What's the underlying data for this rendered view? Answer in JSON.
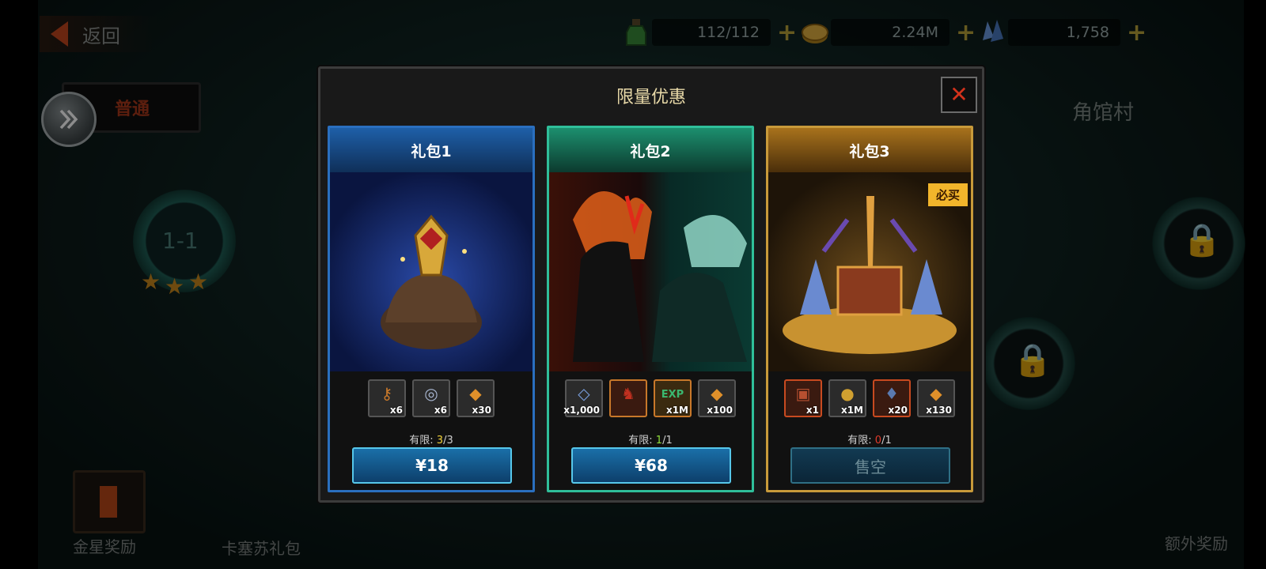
{
  "top_bar": {
    "back_label": "返回",
    "resources": [
      {
        "icon": "potion-icon",
        "value": "112/112",
        "color": "#3a8a3a"
      },
      {
        "icon": "gold-coin-icon",
        "value": "2.24M",
        "color": "#d0a030"
      },
      {
        "icon": "crystal-icon",
        "value": "1,758",
        "color": "#5a8cc8"
      }
    ]
  },
  "map": {
    "mode_tab": "普通",
    "village_label": "角馆村",
    "stage_label": "1-1",
    "bottom_left_label": "金星奖励",
    "bottom_mid_label": "卡塞苏礼包",
    "bottom_right_label": "额外奖励"
  },
  "modal": {
    "title": "限量优惠",
    "cards": [
      {
        "header": "礼包1",
        "theme": "#1e5fa8",
        "limit_label": "有限:",
        "limit_used": "3",
        "limit_total": "/3",
        "limit_color": "#f2d23a",
        "button_label": "¥18",
        "badge": "",
        "items": [
          {
            "icon": "golden-key-icon",
            "qty": "x6",
            "color": "#c8782a"
          },
          {
            "icon": "vortex-orb-icon",
            "qty": "x6",
            "color": "#a8b6d0"
          },
          {
            "icon": "gem-shard-icon",
            "qty": "x30",
            "color": "#e0902a"
          }
        ]
      },
      {
        "header": "礼包2",
        "theme": "#1c8f6e",
        "limit_label": "有限:",
        "limit_used": "1",
        "limit_total": "/1",
        "limit_color": "#8fdc3a",
        "button_label": "¥68",
        "badge": "",
        "items": [
          {
            "icon": "crystal-icon",
            "qty": "x1,000",
            "color": "#7aa0e0"
          },
          {
            "icon": "hero-portrait-icon",
            "qty": "",
            "color": "#c03020"
          },
          {
            "icon": "exp-potion-icon",
            "qty": "x1M",
            "color": "#3ab870"
          },
          {
            "icon": "gem-shard-icon",
            "qty": "x100",
            "color": "#e0902a"
          }
        ]
      },
      {
        "header": "礼包3",
        "theme": "#a8721c",
        "limit_label": "有限:",
        "limit_used": "0",
        "limit_total": "/1",
        "limit_color": "#e03a2a",
        "button_label": "售空",
        "badge": "必买",
        "items": [
          {
            "icon": "treasure-chest-icon",
            "qty": "x1",
            "color": "#b85030"
          },
          {
            "icon": "gold-coin-icon",
            "qty": "x1M",
            "color": "#d0a030"
          },
          {
            "icon": "blue-crystal-icon",
            "qty": "x20",
            "color": "#5a7ab0"
          },
          {
            "icon": "gem-shard-icon",
            "qty": "x130",
            "color": "#e0902a"
          }
        ]
      }
    ]
  }
}
